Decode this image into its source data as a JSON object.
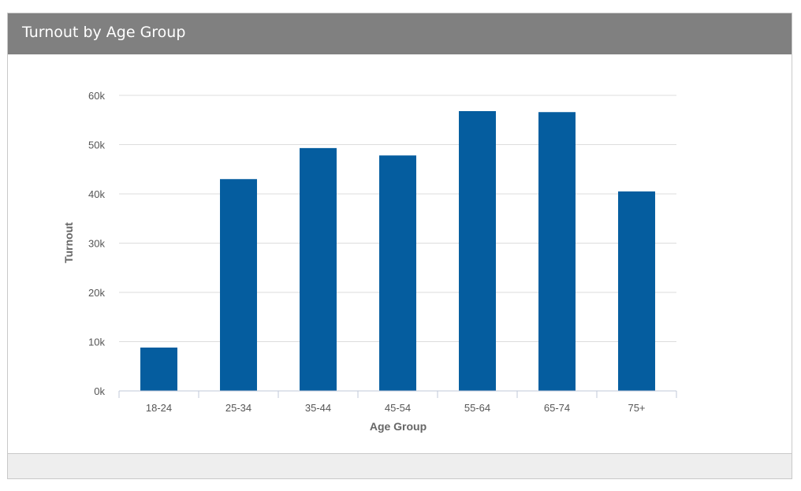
{
  "panel": {
    "title": "Turnout by Age Group"
  },
  "colors": {
    "header_bg": "#808080",
    "bar": "#055d9f",
    "grid": "#dddddd",
    "footer_bg": "#eeeeee"
  },
  "chart_data": {
    "type": "bar",
    "title": "Turnout by Age Group",
    "xlabel": "Age Group",
    "ylabel": "Turnout",
    "categories": [
      "18-24",
      "25-34",
      "35-44",
      "45-54",
      "55-64",
      "65-74",
      "75+"
    ],
    "values": [
      8800,
      43000,
      49300,
      47800,
      56800,
      56600,
      40500
    ],
    "ylim": [
      0,
      60000
    ],
    "yticks": [
      0,
      10000,
      20000,
      30000,
      40000,
      50000,
      60000
    ],
    "ytick_labels": [
      "0k",
      "10k",
      "20k",
      "30k",
      "40k",
      "50k",
      "60k"
    ],
    "grid": true,
    "legend": "none"
  }
}
